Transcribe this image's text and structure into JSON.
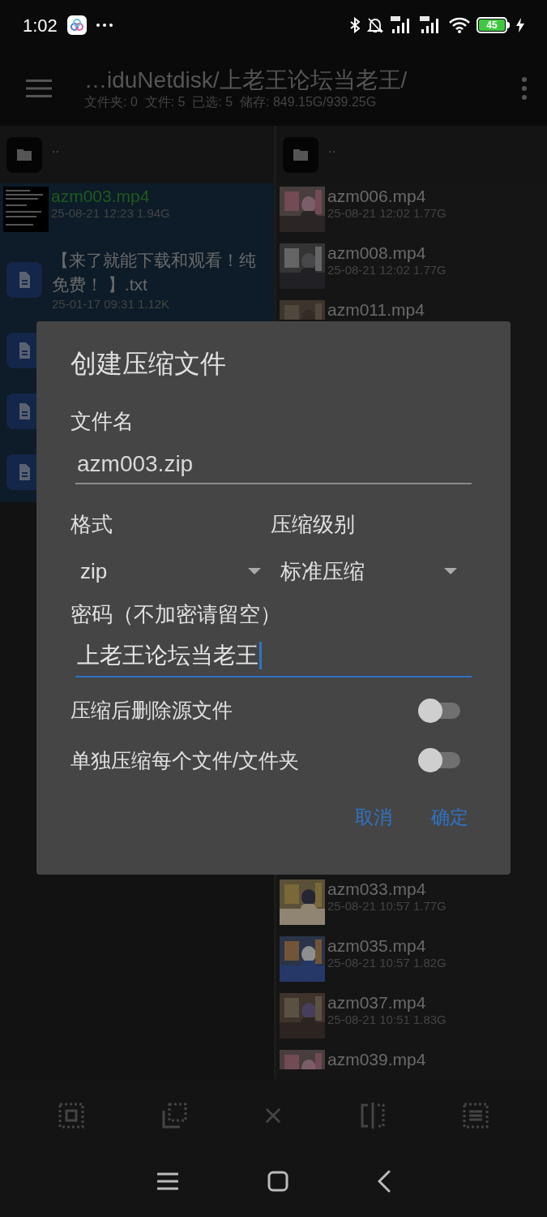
{
  "status_bar": {
    "time": "1:02",
    "battery": "45"
  },
  "toolbar": {
    "title": "…iduNetdisk/上老王论坛当老王/",
    "subtitle": "文件夹: 0  文件: 5  已选: 5  储存: 849.15G/939.25G"
  },
  "left_pane": {
    "items": [
      {
        "kind": "parent",
        "name": "..",
        "selected": false,
        "focused": false
      },
      {
        "kind": "video",
        "name": "azm003.mp4",
        "meta": "25-08-21 12:23  1.94G",
        "selected": true,
        "focused": true
      },
      {
        "kind": "text",
        "name": "【来了就能下载和观看！纯免费！ 】.txt",
        "meta": "25-01-17 09:31  1.12K",
        "selected": true,
        "focused": false
      },
      {
        "kind": "text",
        "selected": true,
        "focused": false
      },
      {
        "kind": "text",
        "selected": true,
        "focused": false
      },
      {
        "kind": "text",
        "selected": true,
        "focused": false
      }
    ]
  },
  "right_pane": {
    "items": [
      {
        "kind": "parent",
        "name": ".."
      },
      {
        "kind": "video",
        "name": "azm006.mp4",
        "meta": "25-08-21 12:02  1.77G"
      },
      {
        "kind": "video",
        "name": "azm008.mp4",
        "meta": "25-08-21 12:02  1.77G"
      },
      {
        "kind": "video",
        "name": "azm011.mp4"
      },
      {
        "kind": "gap"
      },
      {
        "kind": "video",
        "name": "azm033.mp4",
        "meta": "25-08-21 10:57  1.77G"
      },
      {
        "kind": "video",
        "name": "azm035.mp4",
        "meta": "25-08-21 10:57  1.82G"
      },
      {
        "kind": "video",
        "name": "azm037.mp4",
        "meta": "25-08-21 10:51  1.83G"
      },
      {
        "kind": "video",
        "name": "azm039.mp4"
      }
    ]
  },
  "dialog": {
    "title": "创建压缩文件",
    "filename": {
      "label": "文件名",
      "value": "azm003.zip",
      "focused": false
    },
    "format": {
      "label": "格式",
      "value": "zip"
    },
    "level": {
      "label": "压缩级别",
      "value": "标准压缩"
    },
    "password": {
      "label": "密码（不加密请留空）",
      "value": "上老王论坛当老王",
      "focused": true
    },
    "switches": [
      {
        "label": "压缩后删除源文件",
        "on": false
      },
      {
        "label": "单独压缩每个文件/文件夹",
        "on": false
      }
    ],
    "buttons": [
      "取消",
      "确定"
    ]
  }
}
